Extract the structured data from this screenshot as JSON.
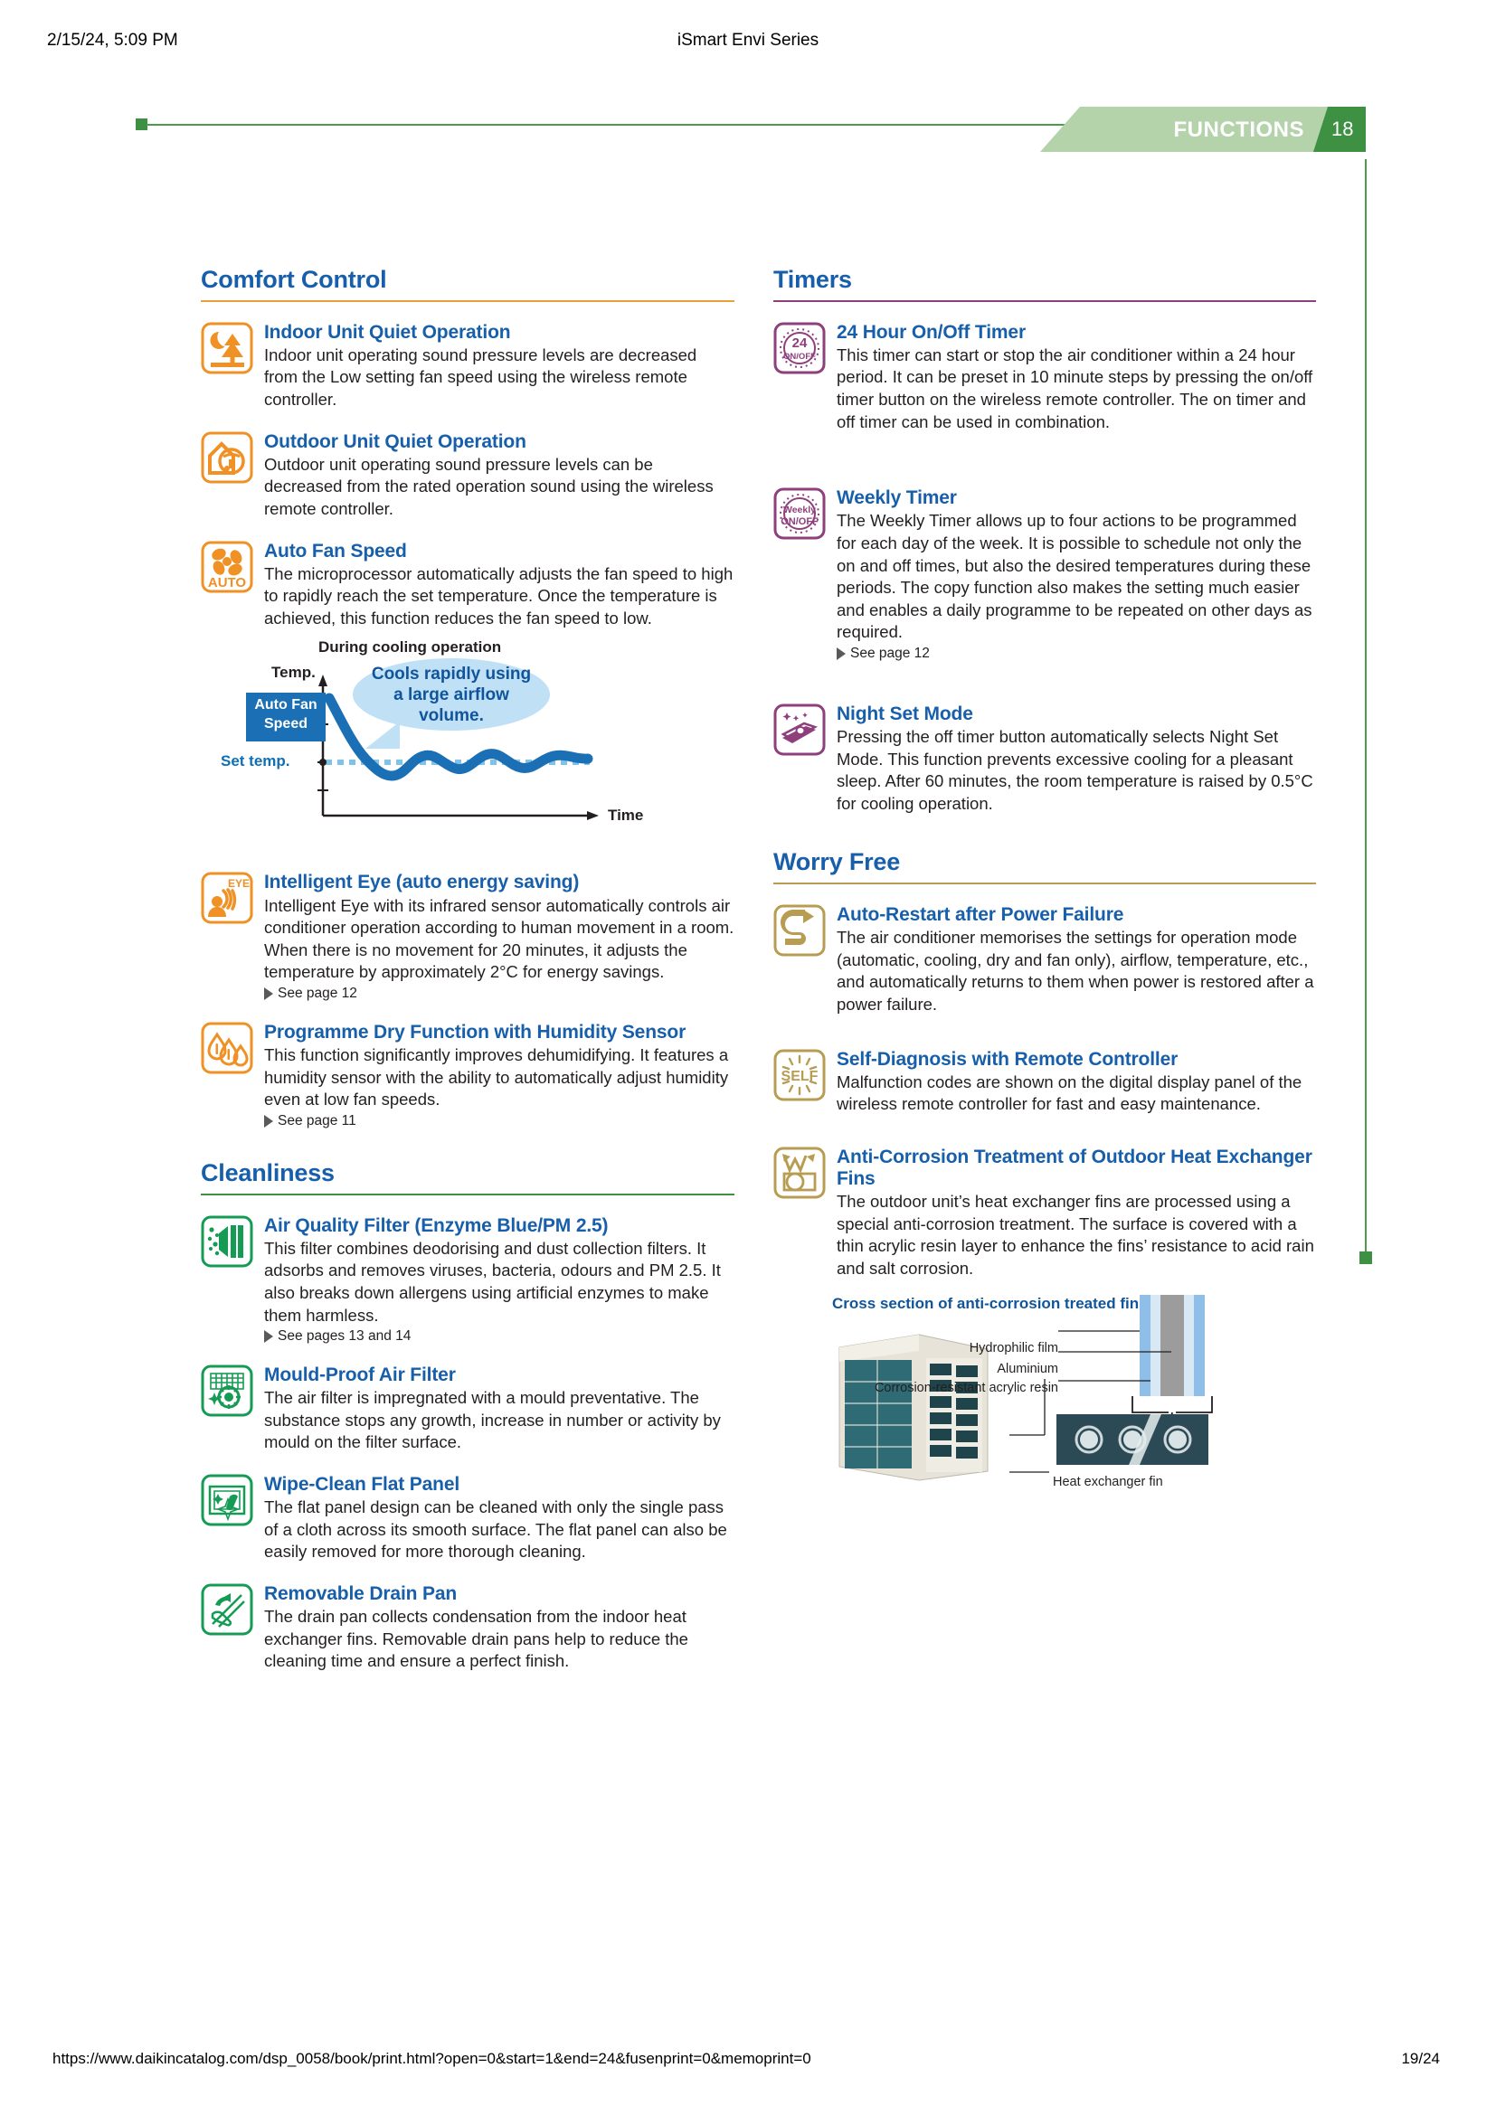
{
  "print": {
    "header_left": "2/15/24, 5:09 PM",
    "header_center": "iSmart Envi Series",
    "footer_url": "https://www.daikincatalog.com/dsp_0058/book/print.html?open=0&start=1&end=24&fusenprint=0&memoprint=0",
    "footer_page": "19/24"
  },
  "banner": {
    "label": "FUNCTIONS",
    "page_number": "18",
    "accent_green": "#3e9142",
    "band_green": "#b4d3ab"
  },
  "colors": {
    "heading_blue": "#175fab",
    "orange": "#ef9125",
    "green": "#159b54",
    "purple": "#8e3f7c",
    "gold": "#b79c52",
    "rule_orange": "#e9a13b",
    "rule_green": "#3e9142",
    "rule_purple": "#8e3f7c",
    "rule_gold": "#b79c52"
  },
  "sections": {
    "comfort": {
      "title": "Comfort Control",
      "features": [
        {
          "icon": "moon-tree-icon",
          "title": "Indoor Unit Quiet Operation",
          "desc": "Indoor unit operating sound pressure levels are decreased from the Low setting fan speed using the wireless remote controller."
        },
        {
          "icon": "house-quiet-icon",
          "title": "Outdoor Unit Quiet Operation",
          "desc": "Outdoor unit operating sound pressure levels can be decreased from the rated operation sound using the wireless remote controller."
        },
        {
          "icon": "auto-fan-icon",
          "title": "Auto Fan Speed",
          "desc": "The microprocessor automatically adjusts the fan speed to high to rapidly reach the set temperature. Once the temperature is achieved, this function reduces the fan speed to low."
        },
        {
          "icon": "intelligent-eye-icon",
          "title": "Intelligent Eye (auto energy saving)",
          "desc": "Intelligent Eye with its infrared sensor automatically controls air conditioner operation according to human movement in a room. When there is no movement for 20 minutes, it adjusts the temperature by approximately 2°C for energy savings.",
          "see_also": "See page 12"
        },
        {
          "icon": "water-drops-icon",
          "title": "Programme Dry Function with Humidity Sensor",
          "desc": "This function significantly improves dehumidifying. It features a humidity sensor with the ability to automatically adjust humidity even at low fan speeds.",
          "see_also": "See page 11"
        }
      ]
    },
    "cleanliness": {
      "title": "Cleanliness",
      "features": [
        {
          "icon": "air-quality-filter-icon",
          "title": "Air Quality Filter (Enzyme Blue/PM 2.5)",
          "desc": "This filter combines deodorising and dust collection filters. It adsorbs and removes viruses, bacteria, odours and PM 2.5. It also breaks down allergens using artificial enzymes to make them harmless.",
          "see_also": "See pages 13 and 14"
        },
        {
          "icon": "mould-proof-filter-icon",
          "title": "Mould-Proof Air Filter",
          "desc": "The air filter is impregnated with a mould preventative. The substance stops any growth, increase in number or activity by mould on the filter surface."
        },
        {
          "icon": "wipe-clean-panel-icon",
          "title": "Wipe-Clean Flat Panel",
          "desc": "The flat panel design can be cleaned with only the single pass of a cloth across its smooth surface. The flat panel can also be easily removed for more thorough cleaning."
        },
        {
          "icon": "drain-pan-icon",
          "title": "Removable Drain Pan",
          "desc": "The drain pan collects condensation from the indoor heat exchanger fins. Removable drain pans help to reduce the cleaning time and ensure a perfect finish."
        }
      ]
    },
    "timers": {
      "title": "Timers",
      "features": [
        {
          "icon": "24-hour-timer-icon",
          "title": "24 Hour On/Off Timer",
          "desc": "This timer can start or stop the air conditioner within a 24 hour period. It can be preset in 10 minute steps by pressing the on/off timer button on the wireless remote controller. The on timer and off timer can be used in combination."
        },
        {
          "icon": "weekly-timer-icon",
          "title": "Weekly Timer",
          "desc": "The Weekly Timer allows up to four actions to be programmed for each day of the week. It is possible to schedule not only the on and off times, but also the desired temperatures during these periods. The copy function also makes the setting much easier and enables a daily programme to be repeated on other days as required.",
          "see_also": "See page 12"
        },
        {
          "icon": "night-set-mode-icon",
          "title": "Night Set Mode",
          "desc": "Pressing the off timer button automatically selects Night Set Mode. This function prevents excessive cooling for a pleasant sleep. After 60 minutes, the room temperature is raised by 0.5°C for cooling operation."
        }
      ]
    },
    "worry_free": {
      "title": "Worry Free",
      "features": [
        {
          "icon": "auto-restart-icon",
          "title": "Auto-Restart after Power Failure",
          "desc": "The air conditioner memorises the settings for operation mode (automatic, cooling, dry and fan only), airflow, temperature, etc., and automatically returns to them when power is restored after a power failure."
        },
        {
          "icon": "self-diagnosis-icon",
          "title": "Self-Diagnosis with Remote Controller",
          "desc": "Malfunction codes are shown on the digital display panel of the wireless remote controller for fast and easy maintenance."
        },
        {
          "icon": "anti-corrosion-icon",
          "title": "Anti-Corrosion Treatment of Outdoor Heat Exchanger Fins",
          "desc": "The outdoor unit’s heat exchanger fins are processed using a special anti-corrosion treatment. The surface is covered with a thin acrylic resin layer to enhance the fins’ resistance to acid rain and salt corrosion."
        }
      ]
    }
  },
  "fan_chart": {
    "title": "During cooling operation",
    "y_axis_label": "Temp.",
    "x_axis_label": "Time",
    "set_temp_label": "Set temp.",
    "badge_line1": "Auto Fan",
    "badge_line2": "Speed",
    "callout": "Cools rapidly using a large airflow volume."
  },
  "chart_data": {
    "type": "line",
    "title": "During cooling operation",
    "xlabel": "Time",
    "ylabel": "Temp.",
    "series": [
      {
        "name": "Auto Fan Speed room temperature",
        "x": [
          0,
          5,
          10,
          15,
          20,
          25,
          30,
          35,
          40,
          45,
          50,
          55,
          60,
          65,
          70,
          75,
          80,
          85,
          90,
          95,
          100
        ],
        "y": [
          88,
          76,
          62,
          50,
          41,
          36,
          34,
          35,
          38,
          40,
          39,
          36,
          34,
          35,
          38,
          40,
          39,
          36,
          35,
          37,
          38
        ]
      }
    ],
    "reference_lines": [
      {
        "name": "Set temp.",
        "y": 37,
        "style": "dotted",
        "color": "#7fc4e8"
      }
    ],
    "annotations": [
      "Cools rapidly using a large airflow volume."
    ],
    "grid": false,
    "legend": "none"
  },
  "cross_section": {
    "caption": "Cross section of anti-corrosion treated fin",
    "labels": [
      "Hydrophilic film",
      "Aluminium",
      "Corrosion-resistant acrylic resin",
      "Heat exchanger fin"
    ]
  }
}
